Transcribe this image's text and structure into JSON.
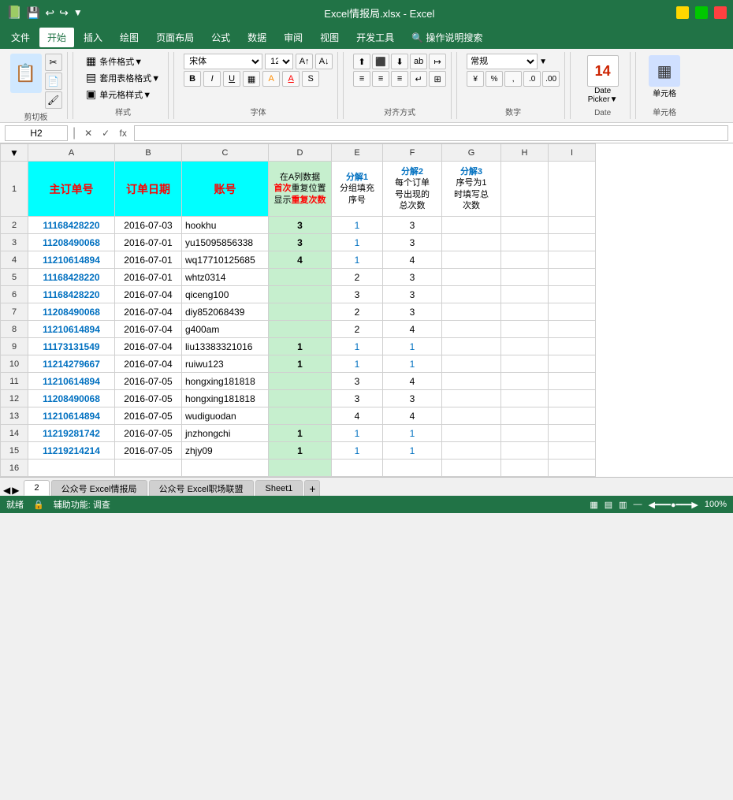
{
  "titleBar": {
    "filename": "Excel情报局.xlsx  -  Excel",
    "quickSave": "💾",
    "undo": "↩",
    "redo": "↪",
    "customize": "▼"
  },
  "menuBar": {
    "items": [
      "文件",
      "开始",
      "插入",
      "绘图",
      "页面布局",
      "公式",
      "数据",
      "审阅",
      "视图",
      "开发工具",
      "🔍 操作说明搜索"
    ],
    "active": "开始"
  },
  "ribbon": {
    "clipboard": {
      "paste_label": "粘贴",
      "cut_label": "剪切板",
      "group_label": "剪切板"
    },
    "style_group": {
      "conditional_format": "条件格式▼",
      "table_format": "套用表格格式▼",
      "cell_style": "单元格样式▼",
      "group_label": "样式"
    },
    "font_group": {
      "font_name": "宋体",
      "font_size": "12",
      "group_label": "字体"
    },
    "align_group": {
      "group_label": "对齐方式"
    },
    "number_group": {
      "format": "常规",
      "group_label": "数字"
    },
    "date_group": {
      "date_picker": "Date\nPicker▼",
      "group_label": "Date"
    },
    "cell_group": {
      "cell_label": "单元格",
      "group_label": "单元格"
    }
  },
  "formulaBar": {
    "cellRef": "H2",
    "formula": ""
  },
  "columns": {
    "corner": "",
    "headers": [
      "A",
      "B",
      "C",
      "D",
      "E",
      "F",
      "G",
      "H",
      "I"
    ],
    "widths": [
      110,
      85,
      110,
      80,
      65,
      75,
      75,
      60,
      60
    ]
  },
  "row1Headers": {
    "A": "主订单号",
    "B": "订单日期",
    "C": "账号",
    "D_line1": "在A列数据",
    "D_line2": "首次",
    "D_line3": "重复位置",
    "D_line4": "显示",
    "D_line5": "重复次数",
    "E_line1": "分解1",
    "E_line2": "分组填充",
    "E_line3": "序号",
    "F_line1": "分解2",
    "F_line2": "每个订单",
    "F_line3": "号出现的",
    "F_line4": "总次数",
    "G_line1": "分解3",
    "G_line2": "序号为1",
    "G_line3": "时填写总",
    "G_line4": "次数"
  },
  "rows": [
    {
      "num": 2,
      "A": "11168428220",
      "B": "2016-07-03",
      "C": "hookhu",
      "D": "3",
      "Dbold": true,
      "E": "1",
      "F": "3",
      "G": ""
    },
    {
      "num": 3,
      "A": "11208490068",
      "B": "2016-07-01",
      "C": "yu15095856338",
      "D": "3",
      "Dbold": true,
      "E": "1",
      "F": "3",
      "G": ""
    },
    {
      "num": 4,
      "A": "11210614894",
      "B": "2016-07-01",
      "C": "wq17710125685",
      "D": "4",
      "Dbold": true,
      "E": "1",
      "F": "4",
      "G": ""
    },
    {
      "num": 5,
      "A": "11168428220",
      "B": "2016-07-01",
      "C": "whtz0314",
      "D": "",
      "Dbold": false,
      "E": "2",
      "F": "3",
      "G": ""
    },
    {
      "num": 6,
      "A": "11168428220",
      "B": "2016-07-04",
      "C": "qiceng100",
      "D": "",
      "Dbold": false,
      "E": "3",
      "F": "3",
      "G": ""
    },
    {
      "num": 7,
      "A": "11208490068",
      "B": "2016-07-04",
      "C": "diy852068439",
      "D": "",
      "Dbold": false,
      "E": "2",
      "F": "3",
      "G": ""
    },
    {
      "num": 8,
      "A": "11210614894",
      "B": "2016-07-04",
      "C": "g400am",
      "D": "",
      "Dbold": false,
      "E": "2",
      "F": "4",
      "G": ""
    },
    {
      "num": 9,
      "A": "11173131549",
      "B": "2016-07-04",
      "C": "liu13383321016",
      "D": "1",
      "Dbold": true,
      "E": "1",
      "F": "1",
      "G": ""
    },
    {
      "num": 10,
      "A": "11214279667",
      "B": "2016-07-04",
      "C": "ruiwu123",
      "D": "1",
      "Dbold": true,
      "E": "1",
      "F": "1",
      "G": ""
    },
    {
      "num": 11,
      "A": "11210614894",
      "B": "2016-07-05",
      "C": "hongxing181818",
      "D": "",
      "Dbold": false,
      "E": "3",
      "F": "4",
      "G": ""
    },
    {
      "num": 12,
      "A": "11208490068",
      "B": "2016-07-05",
      "C": "hongxing181818",
      "D": "",
      "Dbold": false,
      "E": "3",
      "F": "3",
      "G": ""
    },
    {
      "num": 13,
      "A": "11210614894",
      "B": "2016-07-05",
      "C": "wudiguodan",
      "D": "",
      "Dbold": false,
      "E": "4",
      "F": "4",
      "G": ""
    },
    {
      "num": 14,
      "A": "11219281742",
      "B": "2016-07-05",
      "C": "jnzhongchi",
      "D": "1",
      "Dbold": true,
      "E": "1",
      "F": "1",
      "G": ""
    },
    {
      "num": 15,
      "A": "11219214214",
      "B": "2016-07-05",
      "C": "zhjy09",
      "D": "1",
      "Dbold": true,
      "E": "1",
      "F": "1",
      "G": ""
    },
    {
      "num": 16,
      "A": "",
      "B": "",
      "C": "",
      "D": "",
      "Dbold": false,
      "E": "",
      "F": "",
      "G": ""
    }
  ],
  "sheetTabs": {
    "tabs": [
      "2",
      "公众号 Excel情报局",
      "公众号 Excel职场联盟",
      "Sheet1"
    ],
    "active": "2",
    "addLabel": "+"
  },
  "statusBar": {
    "status": "就绪",
    "accessIcon": "🔒",
    "accessText": "辅助功能: 调查",
    "viewBtns": [
      "▦",
      "▤",
      "▥"
    ],
    "zoom": "100%"
  },
  "colors": {
    "excelGreen": "#217346",
    "cyan": "#00ffff",
    "headerRed": "#ff0000",
    "headerBlue": "#0070c0",
    "cellGreen": "#c6efce",
    "textBlue": "#0070c0",
    "boldNum": "#333"
  }
}
